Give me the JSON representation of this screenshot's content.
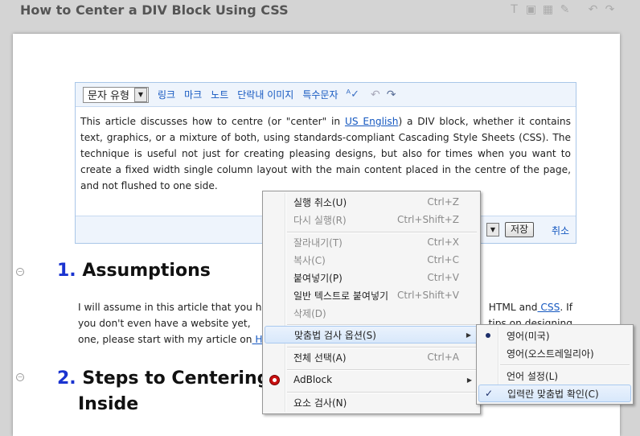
{
  "page": {
    "title": "How to Center a DIV Block Using CSS"
  },
  "editor": {
    "toolbar": {
      "style_select": "문자 유형",
      "links": [
        "링크",
        "마크",
        "노트",
        "단락내 이미지",
        "특수문자"
      ]
    },
    "body": {
      "part1": "This article discusses how to centre (or \"center\" in ",
      "link": "US English",
      "part2": ") a DIV block, whether it contains text, graphics, or a mixture of both, using standards-compliant Cascading Style Sheets (CSS). The technique is useful not just for creating pleasing designs, but also for times when you want to create a fixed width single column layout with the main content placed in the centre of the page, and not flushed to one side."
    },
    "footer": {
      "save": "저장",
      "cancel": "취소"
    }
  },
  "sections": [
    {
      "num": "1.",
      "title": "Assumptions",
      "line1a": "I will assume in this article that you h",
      "line1b": " HTML and",
      "line1link": " CSS",
      "line1c": ". If",
      "line2a": "you don't even have a website yet,",
      "line2b": "tips on designing",
      "line3a": "one, please start with my article on",
      "line3link": " H"
    },
    {
      "num": "2.",
      "title_line1": "Steps to Centering a",
      "title_line2": "Inside"
    }
  ],
  "context_menu": {
    "items": [
      {
        "label": "실행 취소(U)",
        "shortcut": "Ctrl+Z"
      },
      {
        "label": "다시 실행(R)",
        "shortcut": "Ctrl+Shift+Z"
      },
      {
        "label": "잘라내기(T)",
        "shortcut": "Ctrl+X"
      },
      {
        "label": "복사(C)",
        "shortcut": "Ctrl+C"
      },
      {
        "label": "붙여넣기(P)",
        "shortcut": "Ctrl+V"
      },
      {
        "label": "일반 텍스트로 붙여넣기",
        "shortcut": "Ctrl+Shift+V"
      },
      {
        "label": "삭제(D)",
        "shortcut": ""
      },
      {
        "label": "맞춤법 검사 옵션(S)",
        "shortcut": ""
      },
      {
        "label": "전체 선택(A)",
        "shortcut": "Ctrl+A"
      },
      {
        "label": "AdBlock",
        "shortcut": ""
      },
      {
        "label": "요소 검사(N)",
        "shortcut": ""
      }
    ]
  },
  "spell_submenu": {
    "items": [
      {
        "label": "영어(미국)"
      },
      {
        "label": "영어(오스트레일리아)"
      },
      {
        "label": "언어 설정(L)"
      },
      {
        "label": "입력란 맞춤법 확인(C)"
      }
    ]
  },
  "colors": {
    "link": "#1558c0",
    "heading_number": "#1a33d0",
    "menu_hover": "#d8e8fb"
  }
}
